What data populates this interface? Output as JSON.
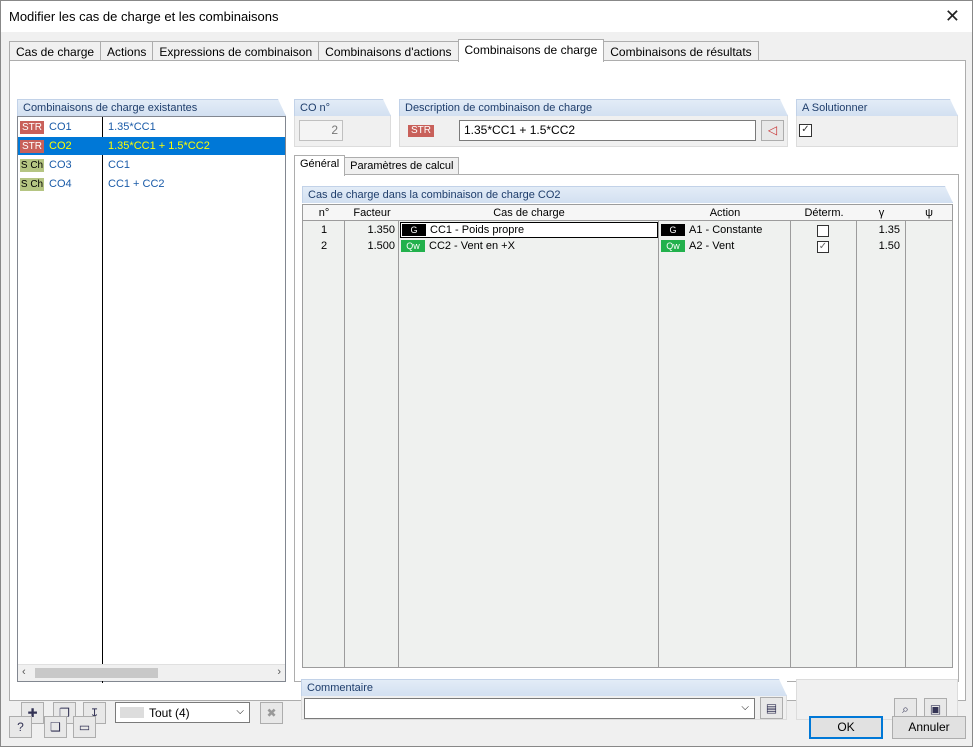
{
  "window": {
    "title": "Modifier les cas de charge et les combinaisons"
  },
  "tabs": [
    {
      "label": "Cas de charge"
    },
    {
      "label": "Actions"
    },
    {
      "label": "Expressions de combinaison"
    },
    {
      "label": "Combinaisons d'actions"
    },
    {
      "label": "Combinaisons de charge"
    },
    {
      "label": "Combinaisons de résultats"
    }
  ],
  "existing": {
    "header": "Combinaisons de charge existantes",
    "items": [
      {
        "badge": "STR",
        "code": "CO1",
        "desc": "1.35*CC1"
      },
      {
        "badge": "STR",
        "code": "CO2",
        "desc": "1.35*CC1 + 1.5*CC2"
      },
      {
        "badge": "S Ch",
        "code": "CO3",
        "desc": "CC1"
      },
      {
        "badge": "S Ch",
        "code": "CO4",
        "desc": "CC1 + CC2"
      }
    ],
    "filter_value": "Tout (4)"
  },
  "co_no": {
    "header": "CO n°",
    "value": "2"
  },
  "description": {
    "header": "Description de combinaison de charge",
    "badge": "STR",
    "value": "1.35*CC1 + 1.5*CC2"
  },
  "solve": {
    "header": "A Solutionner",
    "checked": "✓"
  },
  "subtabs": [
    {
      "label": "Général"
    },
    {
      "label": "Paramètres de calcul"
    }
  ],
  "loadcases": {
    "header": "Cas de charge dans la combinaison de charge CO2",
    "columns": {
      "no": "n°",
      "factor": "Facteur",
      "case": "Cas de charge",
      "action": "Action",
      "determ": "Déterm.",
      "gamma": "γ",
      "psi": "ψ"
    },
    "rows": [
      {
        "no": "1",
        "factor": "1.350",
        "case_tag": "G",
        "case": "CC1 - Poids propre",
        "action_tag": "G",
        "action": "A1 - Constante",
        "determ": "",
        "gamma": "1.35"
      },
      {
        "no": "2",
        "factor": "1.500",
        "case_tag": "Qw",
        "case": "CC2 - Vent en +X",
        "action_tag": "Qw",
        "action": "A2 - Vent",
        "determ": "✓",
        "gamma": "1.50"
      }
    ]
  },
  "comment": {
    "header": "Commentaire",
    "value": ""
  },
  "buttons": {
    "ok": "OK",
    "cancel": "Annuler"
  }
}
